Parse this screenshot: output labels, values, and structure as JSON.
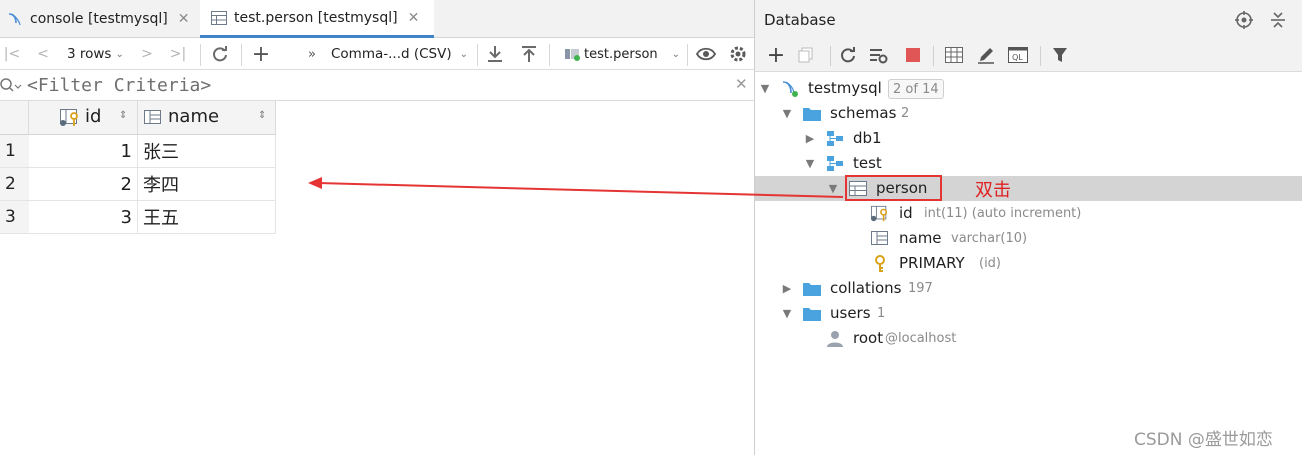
{
  "editor": {
    "tabs": [
      {
        "label": "console [testmysql]"
      },
      {
        "label": "test.person [testmysql]"
      }
    ],
    "toolbar": {
      "rows_label": "3 rows",
      "export_format": "Comma-...d (CSV)",
      "table_ref": "test.person"
    },
    "filter_placeholder": "<Filter Criteria>",
    "table": {
      "columns": [
        {
          "label": "id"
        },
        {
          "label": "name"
        }
      ],
      "rows": [
        {
          "num": "1",
          "id": "1",
          "name": "张三"
        },
        {
          "num": "2",
          "id": "2",
          "name": "李四"
        },
        {
          "num": "3",
          "id": "3",
          "name": "王五"
        }
      ]
    }
  },
  "database_panel": {
    "title": "Database",
    "tree": {
      "connection": {
        "label": "testmysql",
        "badge": "2 of 14"
      },
      "schemas": {
        "label": "schemas",
        "count": "2"
      },
      "db1": {
        "label": "db1"
      },
      "test": {
        "label": "test"
      },
      "person": {
        "label": "person"
      },
      "col_id": {
        "label": "id",
        "type": "int(11) (auto increment)"
      },
      "col_name": {
        "label": "name",
        "type": "varchar(10)"
      },
      "primary": {
        "label": "PRIMARY",
        "meta": "(id)"
      },
      "collations": {
        "label": "collations",
        "count": "197"
      },
      "users": {
        "label": "users",
        "count": "1"
      },
      "root": {
        "label": "root",
        "host": "@localhost"
      }
    }
  },
  "annotation": {
    "text": "双击",
    "color": "#e02020"
  },
  "watermark": "CSDN @盛世如恋",
  "colors": {
    "accent": "#4083c9",
    "folder": "#4aa3df",
    "annotation": "#e53434",
    "stop": "#e05555"
  }
}
